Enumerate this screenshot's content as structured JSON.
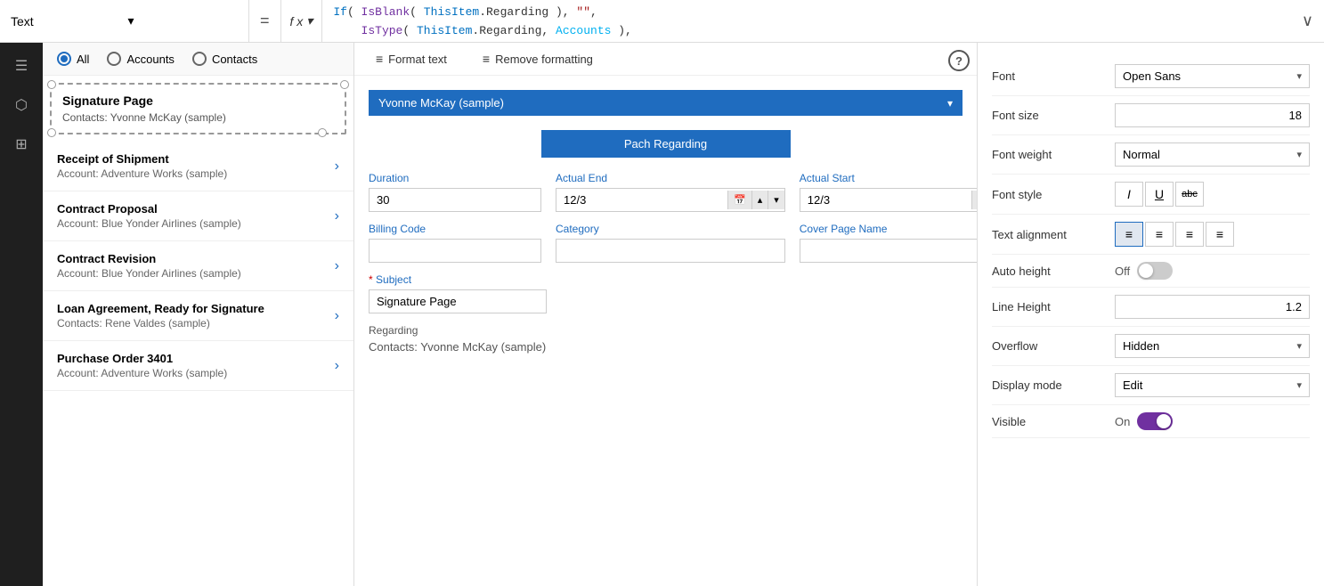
{
  "formulaBar": {
    "dropdownLabel": "Text",
    "equalsSign": "=",
    "fxLabel": "f x",
    "code": "If( IsBlank( ThisItem.Regarding ), \"\",\n    IsType( ThisItem.Regarding, Accounts ),\n        \"Account: \" & AsType( ThisItem.Regarding, Accounts ).'Account Name',\n    IsType( ThisItem.Regarding, Contacts ),\n        \"Contacts: \" & AsType( ThisItem.Regarding, Contacts ).'Full Name',\n    \"\"\n)",
    "expandIcon": "∨"
  },
  "filterBar": {
    "options": [
      "All",
      "Accounts",
      "Contacts"
    ],
    "selected": "All"
  },
  "signatureCard": {
    "title": "Signature Page",
    "subtitle": "Contacts: Yvonne McKay (sample)"
  },
  "listItems": [
    {
      "title": "Receipt of Shipment",
      "sub": "Account: Adventure Works (sample)"
    },
    {
      "title": "Contract Proposal",
      "sub": "Account: Blue Yonder Airlines (sample)"
    },
    {
      "title": "Contract Revision",
      "sub": "Account: Blue Yonder Airlines (sample)"
    },
    {
      "title": "Loan Agreement, Ready for Signature",
      "sub": "Contacts: Rene Valdes (sample)"
    },
    {
      "title": "Purchase Order 3401",
      "sub": "Account: Adventure Works (sample)"
    }
  ],
  "toolbar": {
    "formatTextLabel": "Format text",
    "removeFormattingLabel": "Remove formatting"
  },
  "form": {
    "nameDropdownValue": "Yvonne McKay (sample)",
    "patchButton": "Pach Regarding",
    "fields": {
      "duration": {
        "label": "Duration",
        "value": "30"
      },
      "actualEnd": {
        "label": "Actual End",
        "value": "12/3"
      },
      "actualStart": {
        "label": "Actual Start",
        "value": "12/3"
      },
      "billingCode": {
        "label": "Billing Code",
        "value": ""
      },
      "category": {
        "label": "Category",
        "value": ""
      },
      "coverPageName": {
        "label": "Cover Page Name",
        "value": ""
      }
    },
    "subjectLabel": "Subject",
    "subjectValue": "Signature Page",
    "regardingLabel": "Regarding",
    "regardingValue": "Contacts: Yvonne McKay (sample)"
  },
  "properties": {
    "font": {
      "label": "Font",
      "value": "Open Sans"
    },
    "fontSize": {
      "label": "Font size",
      "value": "18"
    },
    "fontWeight": {
      "label": "Font weight",
      "value": "Normal"
    },
    "fontStyle": {
      "label": "Font style",
      "buttons": [
        "I",
        "U",
        "abc"
      ]
    },
    "textAlignment": {
      "label": "Text alignment",
      "buttons": [
        "≡",
        "≡",
        "≡",
        "≡"
      ],
      "activeIndex": 0
    },
    "autoHeight": {
      "label": "Auto height",
      "toggleState": "off",
      "toggleLabel": "Off"
    },
    "lineHeight": {
      "label": "Line Height",
      "value": "1.2"
    },
    "overflow": {
      "label": "Overflow",
      "value": "Hidden"
    },
    "displayMode": {
      "label": "Display mode",
      "value": "Edit"
    },
    "visible": {
      "label": "Visible",
      "toggleState": "on",
      "toggleLabel": "On"
    }
  }
}
